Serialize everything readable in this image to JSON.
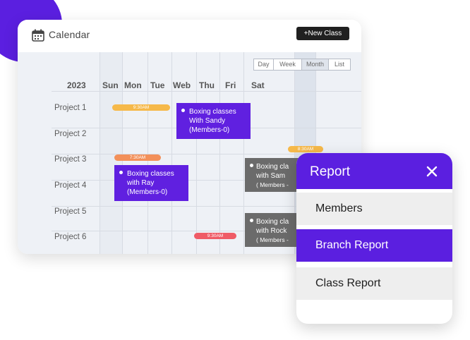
{
  "calendar": {
    "title": "Calendar",
    "new_class_label": "+New Class",
    "views": [
      {
        "label": "Day",
        "active": false
      },
      {
        "label": "Week",
        "active": false
      },
      {
        "label": "Month",
        "active": true
      },
      {
        "label": "List",
        "active": false
      }
    ],
    "year": "2023",
    "days": [
      "Sun",
      "Mon",
      "Tue",
      "Web",
      "Thu",
      "Fri",
      "Sat"
    ],
    "rows": [
      "Project 1",
      "Project 2",
      "Project 3",
      "Project 4",
      "Project 5",
      "Project 6"
    ],
    "pills": [
      "9:30AM",
      "7:30AM",
      "9:30AM",
      "8:30AM"
    ],
    "events": [
      {
        "title": "Boxing classes",
        "line2": "With Sandy",
        "line3": "(Members-0)"
      },
      {
        "title": "Boxing classes",
        "line2": "with Ray",
        "line3": "(Members-0)"
      },
      {
        "title": "Boxing cla",
        "line2": "with Sam",
        "line3": "( Members -"
      },
      {
        "title": "Boxing cla",
        "line2": "with Rock",
        "line3": "( Members -"
      }
    ],
    "colors": {
      "purple": "#6020e0",
      "gray": "#6b6b6b",
      "yellow": "#f6b94a",
      "orange": "#f3905a",
      "red": "#ef5b66"
    }
  },
  "report": {
    "title": "Report",
    "items": [
      {
        "label": "Members",
        "active": false
      },
      {
        "label": "Branch Report",
        "active": true
      },
      {
        "label": "Class Report",
        "active": false
      }
    ],
    "accent": "#5b1fe0"
  }
}
